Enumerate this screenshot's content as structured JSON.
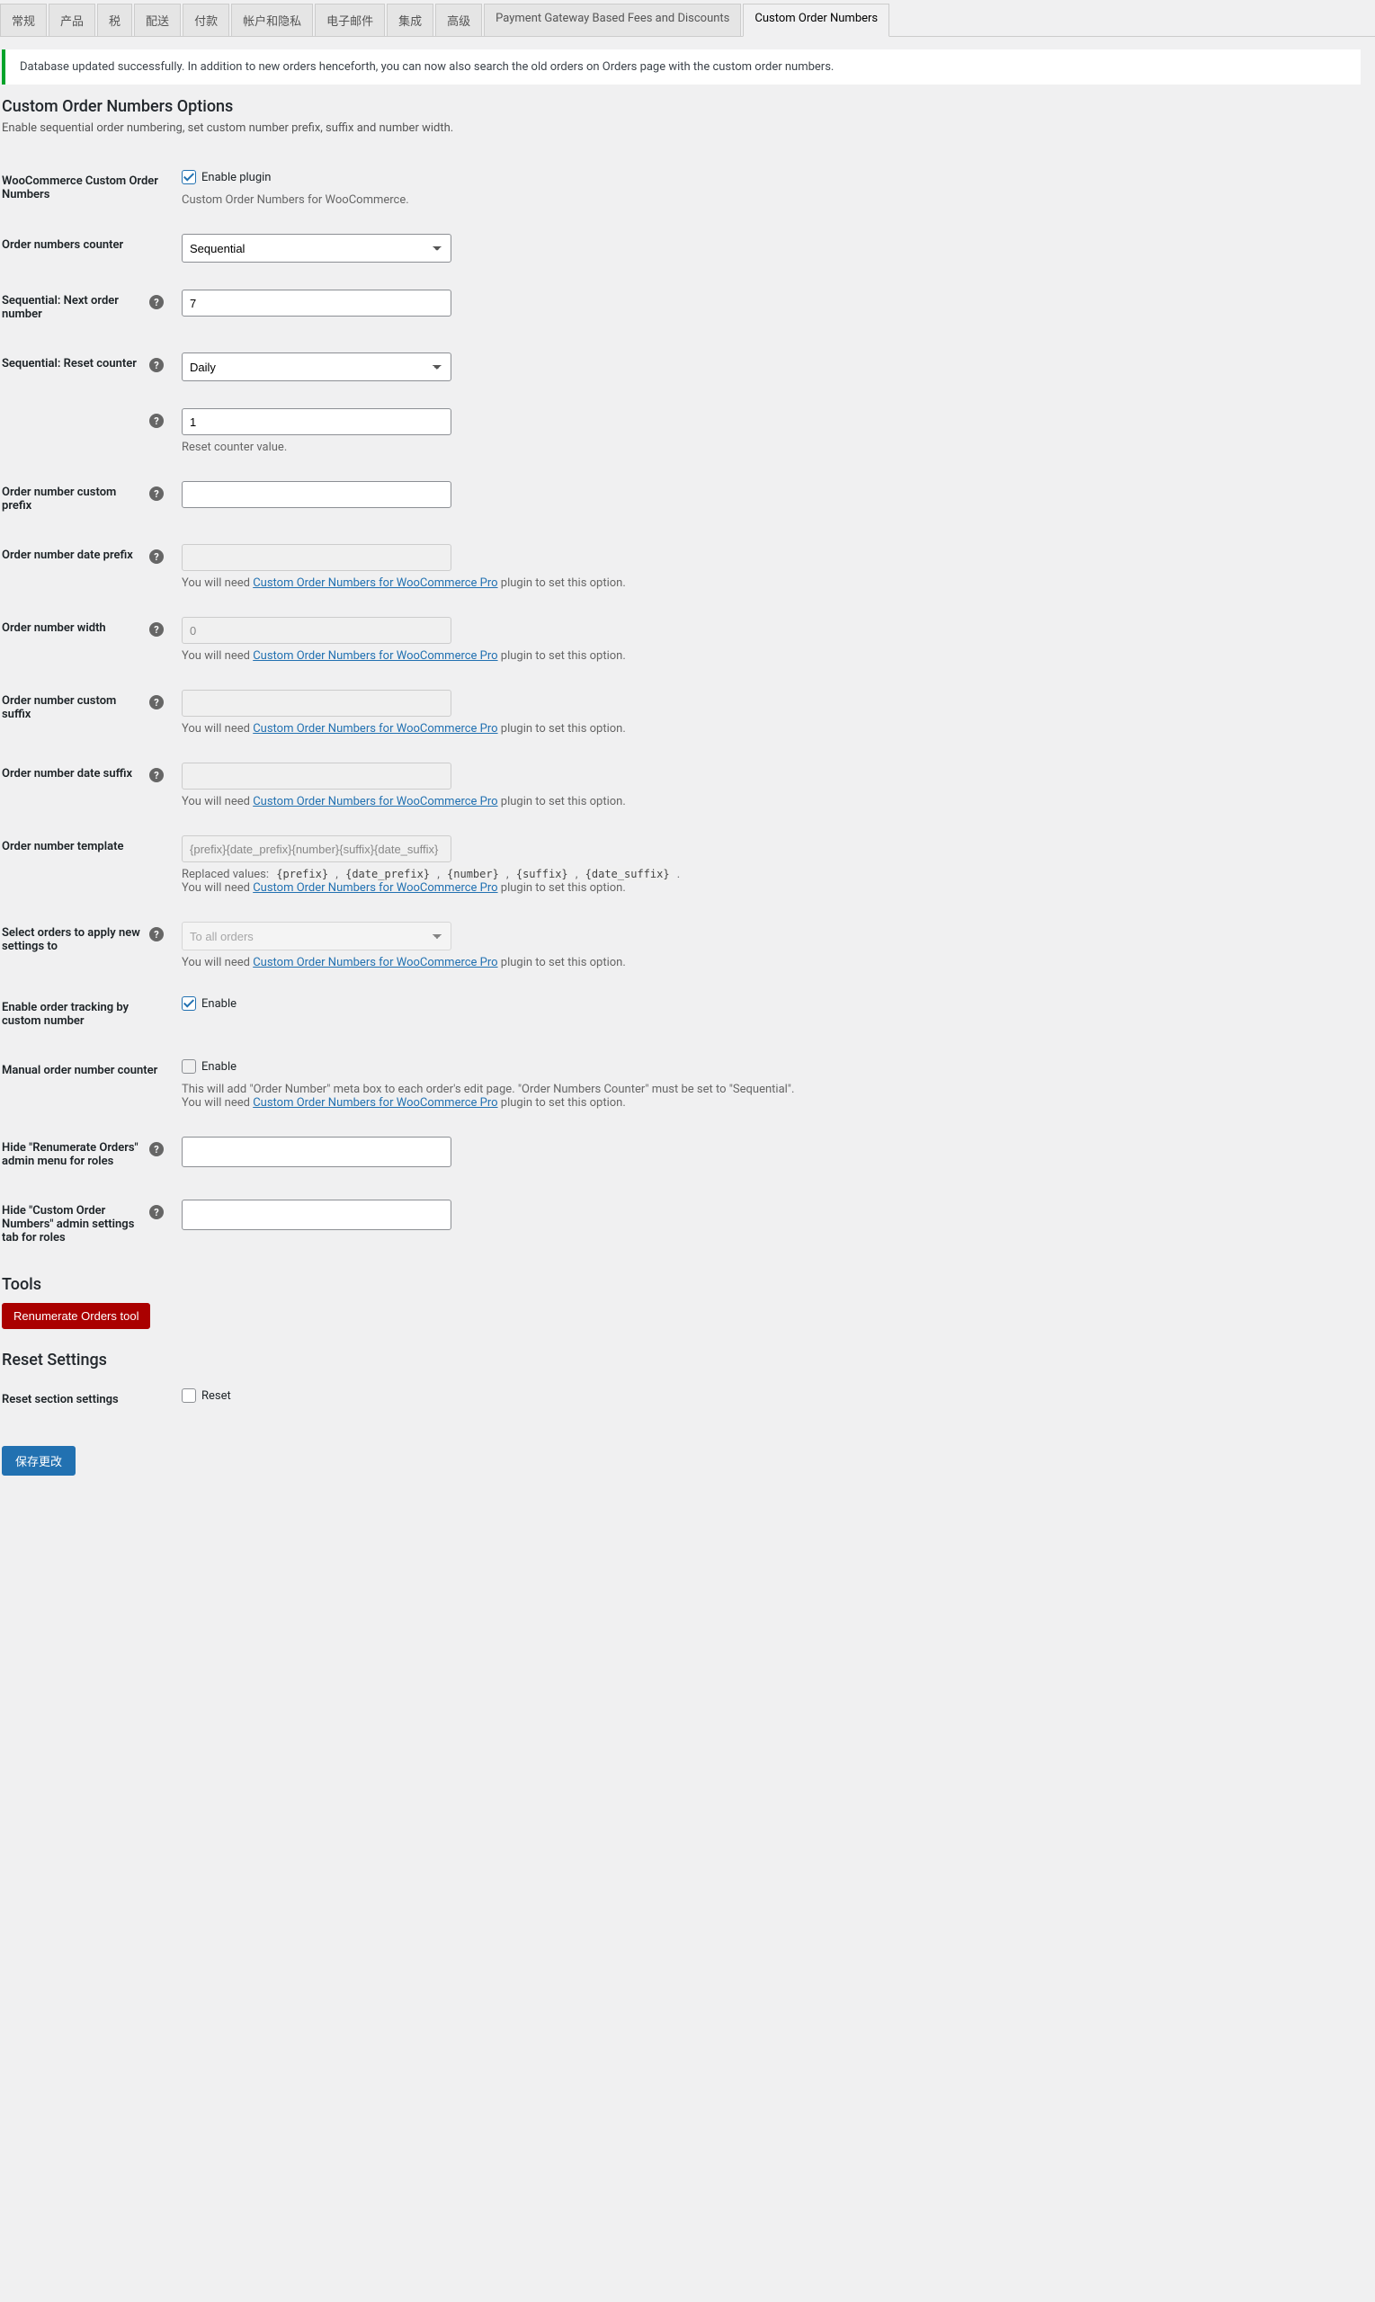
{
  "tabs": {
    "general": "常规",
    "products": "产品",
    "tax": "税",
    "shipping": "配送",
    "checkout": "付款",
    "accounts": "帐户和隐私",
    "emails": "电子邮件",
    "integration": "集成",
    "advanced": "高级",
    "payment_gateway": "Payment Gateway Based Fees and Discounts",
    "custom_order_numbers": "Custom Order Numbers"
  },
  "notice": "Database updated successfully. In addition to new orders henceforth, you can now also search the old orders on Orders page with the custom order numbers.",
  "section": {
    "heading": "Custom Order Numbers Options",
    "desc": "Enable sequential order numbering, set custom number prefix, suffix and number width."
  },
  "fields": {
    "enable_plugin": {
      "label": "WooCommerce Custom Order Numbers",
      "check_label": "Enable plugin",
      "desc": "Custom Order Numbers for WooCommerce."
    },
    "counter": {
      "label": "Order numbers counter",
      "value": "Sequential"
    },
    "next_number": {
      "label": "Sequential: Next order number",
      "value": "7"
    },
    "reset_counter": {
      "label": "Sequential: Reset counter",
      "value": "Daily"
    },
    "reset_value": {
      "value": "1",
      "desc": "Reset counter value."
    },
    "custom_prefix": {
      "label": "Order number custom prefix",
      "value": ""
    },
    "date_prefix": {
      "label": "Order number date prefix",
      "value": ""
    },
    "width": {
      "label": "Order number width",
      "value": "0"
    },
    "custom_suffix": {
      "label": "Order number custom suffix",
      "value": ""
    },
    "date_suffix": {
      "label": "Order number date suffix",
      "value": ""
    },
    "template": {
      "label": "Order number template",
      "value": "{prefix}{date_prefix}{number}{suffix}{date_suffix}",
      "replaced_label": "Replaced values: ",
      "codes": [
        "{prefix}",
        "{date_prefix}",
        "{number}",
        "{suffix}",
        "{date_suffix}"
      ]
    },
    "apply_to": {
      "label": "Select orders to apply new settings to",
      "value": "To all orders"
    },
    "tracking": {
      "label": "Enable order tracking by custom number",
      "check_label": "Enable"
    },
    "manual": {
      "label": "Manual order number counter",
      "check_label": "Enable",
      "desc1": "This will add \"Order Number\" meta box to each order's edit page. \"Order Numbers Counter\" must be set to \"Sequential\"."
    },
    "hide_menu": {
      "label": "Hide \"Renumerate Orders\" admin menu for roles"
    },
    "hide_tab": {
      "label": "Hide \"Custom Order Numbers\" admin settings tab for roles"
    }
  },
  "pro_notice": {
    "prefix": "You will need ",
    "link": "Custom Order Numbers for WooCommerce Pro",
    "suffix": " plugin to set this option."
  },
  "tools": {
    "heading": "Tools",
    "renumerate_btn": "Renumerate Orders tool"
  },
  "reset": {
    "heading": "Reset Settings",
    "label": "Reset section settings",
    "check_label": "Reset"
  },
  "save": "保存更改"
}
